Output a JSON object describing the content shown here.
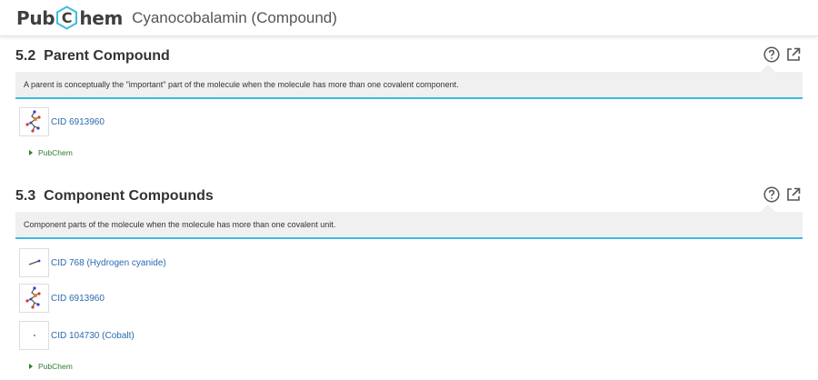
{
  "header": {
    "logo_left": "Pub",
    "logo_mid": "C",
    "logo_right": "hem",
    "title": "Cyanocobalamin (Compound)"
  },
  "colors": {
    "accent": "#3dbbe4",
    "link": "#2a6bb0",
    "source": "#2e7d32"
  },
  "sections": [
    {
      "number": "5.2",
      "title": "Parent Compound",
      "description": "A parent is conceptually the \"important\" part of the molecule when the molecule has more than one covalent component.",
      "compounds": [
        {
          "label": "CID 6913960",
          "thumb": "cobalamin-structure-icon"
        }
      ],
      "source": "PubChem"
    },
    {
      "number": "5.3",
      "title": "Component Compounds",
      "description": "Component parts of the molecule when the molecule has more than one covalent unit.",
      "compounds": [
        {
          "label": "CID 768 (Hydrogen cyanide)",
          "thumb": "hydrogen-cyanide-structure-icon"
        },
        {
          "label": "CID 6913960",
          "thumb": "cobalamin-structure-icon"
        },
        {
          "label": "CID 104730 (Cobalt)",
          "thumb": "cobalt-structure-icon"
        }
      ],
      "source": "PubChem"
    }
  ],
  "icons": {
    "help": "help-circle-icon",
    "external": "external-link-icon"
  }
}
